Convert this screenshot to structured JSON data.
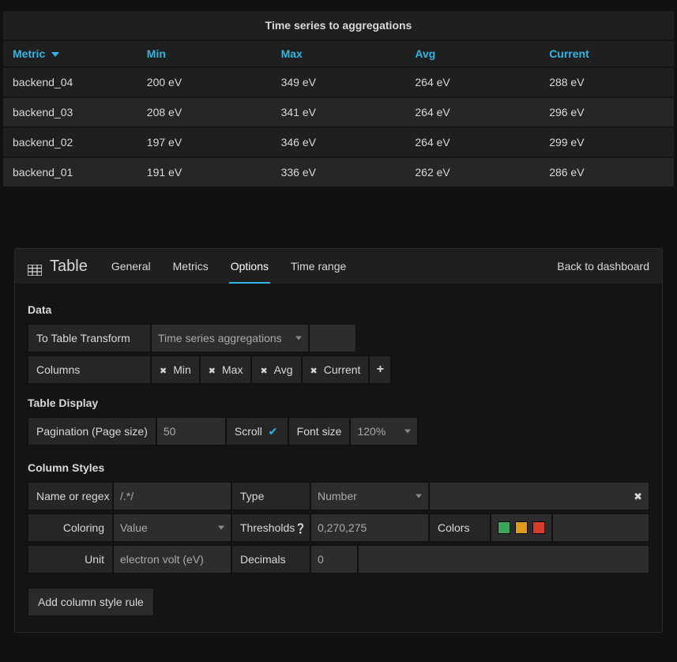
{
  "table": {
    "title": "Time series to aggregations",
    "columns": [
      "Metric",
      "Min",
      "Max",
      "Avg",
      "Current"
    ],
    "rows": [
      {
        "metric": "backend_04",
        "min": "200 eV",
        "max": "349 eV",
        "avg": "264 eV",
        "current": "288 eV"
      },
      {
        "metric": "backend_03",
        "min": "208 eV",
        "max": "341 eV",
        "avg": "264 eV",
        "current": "296 eV"
      },
      {
        "metric": "backend_02",
        "min": "197 eV",
        "max": "346 eV",
        "avg": "264 eV",
        "current": "299 eV"
      },
      {
        "metric": "backend_01",
        "min": "191 eV",
        "max": "336 eV",
        "avg": "262 eV",
        "current": "286 eV"
      }
    ]
  },
  "editor": {
    "panel_type": "Table",
    "tabs": [
      "General",
      "Metrics",
      "Options",
      "Time range"
    ],
    "active_tab": "Options",
    "back_link": "Back to dashboard",
    "data_section": {
      "title": "Data",
      "transform_label": "To Table Transform",
      "transform_value": "Time series aggregations",
      "columns_label": "Columns",
      "column_chips": [
        "Min",
        "Max",
        "Avg",
        "Current"
      ]
    },
    "display_section": {
      "title": "Table Display",
      "pagination_label": "Pagination (Page size)",
      "pagination_value": "50",
      "scroll_label": "Scroll",
      "scroll_checked": true,
      "font_size_label": "Font size",
      "font_size_value": "120%"
    },
    "styles_section": {
      "title": "Column Styles",
      "name_label": "Name or regex",
      "name_value": "/.*/",
      "type_label": "Type",
      "type_value": "Number",
      "coloring_label": "Coloring",
      "coloring_value": "Value",
      "thresholds_label": "Thresholds",
      "thresholds_value": "0,270,275",
      "colors_label": "Colors",
      "unit_label": "Unit",
      "unit_value": "electron volt (eV)",
      "decimals_label": "Decimals",
      "decimals_value": "0",
      "add_rule_label": "Add column style rule",
      "colors": [
        "#3aa657",
        "#e09b1d",
        "#d93c2e"
      ]
    }
  }
}
